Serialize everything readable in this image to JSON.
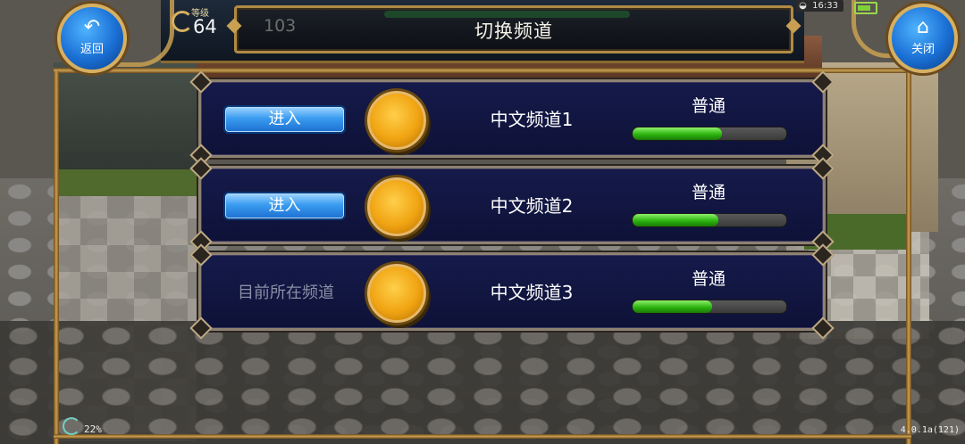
{
  "header": {
    "title": "切换频道",
    "back_label": "返回",
    "close_label": "关闭",
    "level_label": "等级",
    "level_value": "64",
    "ghost_number": "103"
  },
  "status": {
    "time": "16:33"
  },
  "channels": [
    {
      "action_label": "进入",
      "name": "中文频道1",
      "load_label": "普通",
      "load_fraction": 0.58,
      "is_current": false
    },
    {
      "action_label": "进入",
      "name": "中文频道2",
      "load_label": "普通",
      "load_fraction": 0.56,
      "is_current": false
    },
    {
      "action_label": "目前所在频道",
      "name": "中文频道3",
      "load_label": "普通",
      "load_fraction": 0.52,
      "is_current": true
    }
  ],
  "footer": {
    "percent": "22%",
    "version": "4.0.1a(121)"
  },
  "colors": {
    "panel_bg": "#121745",
    "load_fill": "#2bb40f",
    "enter_button": "#3a9cf0",
    "frame_gold": "#c9a052"
  }
}
